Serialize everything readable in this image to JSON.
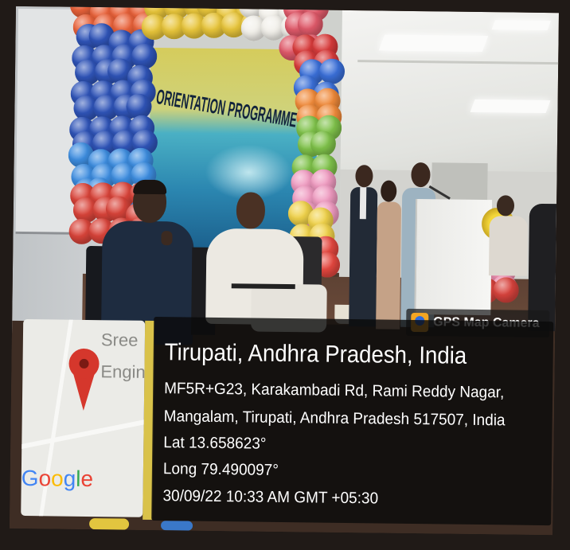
{
  "banner": {
    "text": "ORIENTATION PROGRAMME"
  },
  "app_badge": {
    "label": "GPS Map Camera",
    "icon": "gps-map-camera-icon"
  },
  "map": {
    "labels": [
      "Sree",
      "Engin"
    ],
    "pin_icon": "location-pin-icon",
    "attribution": "Google"
  },
  "location": {
    "title": "Tirupati, Andhra Pradesh, India",
    "address_line_1": "MF5R+G23, Karakambadi Rd, Rami Reddy Nagar,",
    "address_line_2": "Mangalam, Tirupati, Andhra Pradesh 517507, India",
    "latitude": "Lat 13.658623°",
    "longitude": "Long 79.490097°",
    "timestamp": "30/09/22 10:33 AM GMT +05:30"
  },
  "colors": {
    "info_panel": "#0a0a0a",
    "info_text": "#ffffff",
    "pin": "#d5372c",
    "badge_icon": "#f4a623",
    "google_letters": [
      "#4285f4",
      "#ea4335",
      "#fbbc05",
      "#4285f4",
      "#34a853",
      "#ea4335"
    ]
  }
}
